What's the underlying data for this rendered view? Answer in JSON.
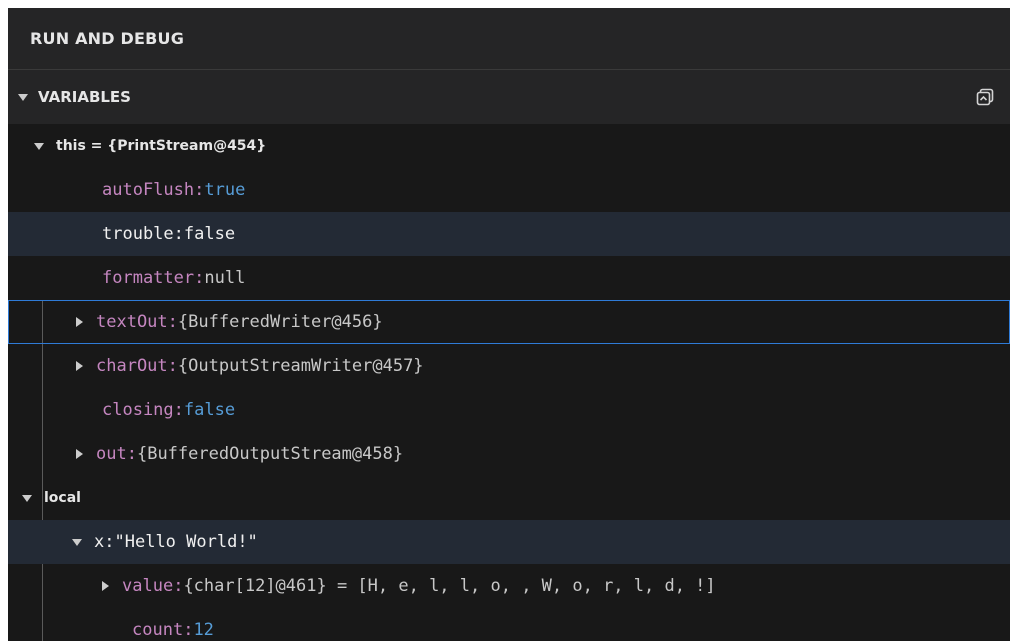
{
  "panel": {
    "title": "RUN AND DEBUG"
  },
  "variables": {
    "header": "VARIABLES",
    "scopes": [
      {
        "label": "this = {PrintStream@454}",
        "items": [
          {
            "name": "autoFlush",
            "value": "true"
          },
          {
            "name": "trouble",
            "value": "false"
          },
          {
            "name": "formatter",
            "value": "null"
          },
          {
            "name": "textOut",
            "value": "{BufferedWriter@456}"
          },
          {
            "name": "charOut",
            "value": "{OutputStreamWriter@457}"
          },
          {
            "name": "closing",
            "value": "false"
          },
          {
            "name": "out",
            "value": "{BufferedOutputStream@458}"
          }
        ]
      },
      {
        "label": "local",
        "items": [
          {
            "name": "x",
            "value": "\"Hello World!\""
          },
          {
            "name": "value",
            "value": "{char[12]@461} = [H, e, l, l, o,  , W, o, r, l, d, !]"
          },
          {
            "name": "count",
            "value": "12"
          }
        ]
      }
    ]
  },
  "colors": {
    "background": "#181818",
    "header_bg": "#252526",
    "name": "#c586c0",
    "boolean_value": "#569cd6",
    "selection_outline": "#2f7bd6"
  },
  "icons": {
    "collapse_all": "collapse-all-icon",
    "expanded": "chevron-down-icon",
    "collapsed": "chevron-right-icon"
  }
}
